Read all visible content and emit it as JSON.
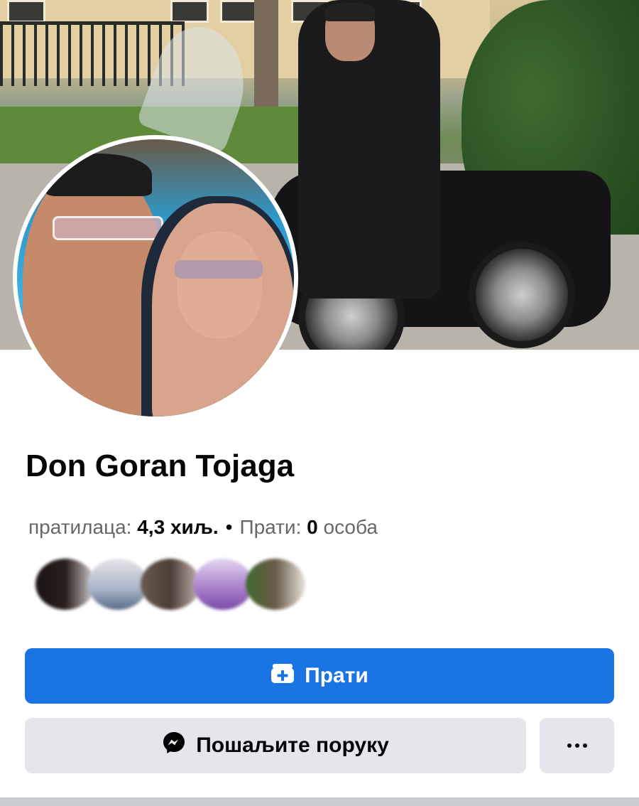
{
  "profile": {
    "name": "Don Goran Tojaga",
    "followers_label": "пратилаца: ",
    "followers_value": "4,3 хиљ.",
    "separator": "•",
    "following_label": "Прати: ",
    "following_value": "0",
    "following_unit": " особа"
  },
  "actions": {
    "follow_label": "Прати",
    "message_label": "Пошаљите поруку",
    "follow_icon": "follow-plus-icon",
    "message_icon": "messenger-icon",
    "more_icon": "more-dots-icon"
  },
  "colors": {
    "primary": "#1b74e4",
    "secondary": "#e4e6eb",
    "text": "#050505",
    "muted": "#65676b"
  }
}
